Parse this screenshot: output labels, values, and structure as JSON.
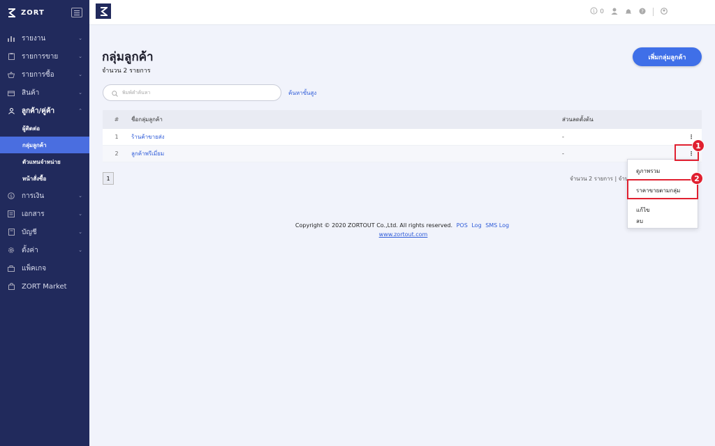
{
  "sidebar": {
    "logo": "ZORT",
    "items": [
      {
        "label": "รายงาน",
        "icon": "chart-icon",
        "chevron": "⌄"
      },
      {
        "label": "รายการขาย",
        "icon": "clipboard-icon",
        "chevron": "⌄"
      },
      {
        "label": "รายการซื้อ",
        "icon": "basket-icon",
        "chevron": "⌄"
      },
      {
        "label": "สินค้า",
        "icon": "box-icon",
        "chevron": "⌄"
      },
      {
        "label": "ลูกค้า/คู่ค้า",
        "icon": "users-icon",
        "chevron": "⌃"
      },
      {
        "label": "การเงิน",
        "icon": "dollar-icon",
        "chevron": "⌄"
      },
      {
        "label": "เอกสาร",
        "icon": "document-icon",
        "chevron": "⌄"
      },
      {
        "label": "บัญชี",
        "icon": "book-icon",
        "chevron": "⌄"
      },
      {
        "label": "ตั้งค่า",
        "icon": "gear-icon",
        "chevron": "⌄"
      },
      {
        "label": "แพ็คเกจ",
        "icon": "package-icon",
        "chevron": ""
      },
      {
        "label": "ZORT Market",
        "icon": "bag-icon",
        "chevron": ""
      }
    ],
    "sub_items": [
      {
        "label": "ผู้ติดต่อ"
      },
      {
        "label": "กลุ่มลูกค้า"
      },
      {
        "label": "ตัวแทนจำหน่าย"
      },
      {
        "label": "หน้าสั่งซื้อ"
      }
    ]
  },
  "topbar": {
    "credits": "0"
  },
  "page": {
    "title": "กลุ่มลูกค้า",
    "subtitle": "จำนวน 2 รายการ",
    "add_button": "เพิ่มกลุ่มลูกค้า",
    "search_placeholder": "พิมพ์คำค้นหา",
    "advanced_search": "ค้นหาขั้นสูง"
  },
  "table": {
    "headers": {
      "num": "#",
      "name": "ชื่อกลุ่มลูกค้า",
      "discount": "ส่วนลดตั้งต้น"
    },
    "rows": [
      {
        "num": "1",
        "name": "ร้านค้าขายส่ง",
        "discount": "-"
      },
      {
        "num": "2",
        "name": "ลูกค้าพรีเมี่ยม",
        "discount": "-"
      }
    ]
  },
  "pagination": {
    "current_page": "1",
    "total_text": "จำนวน 2 รายการ | จำน"
  },
  "footer": {
    "copyright": "Copyright © 2020 ZORTOUT Co.,Ltd. All rights reserved.",
    "links": [
      "POS",
      "Log",
      "SMS Log"
    ],
    "website": "www.zortout.com"
  },
  "dropdown": {
    "items": [
      "ดูภาพรวม",
      "ราคาขายตามกลุ่ม",
      "แก้ไข",
      "ลบ"
    ]
  },
  "annotations": [
    "1",
    "2"
  ],
  "colors": {
    "sidebar_bg": "#212a5c",
    "active_item": "#4a6ee0",
    "primary_button": "#3f6fe8",
    "link": "#2e5bd8",
    "highlight": "#e02030"
  }
}
